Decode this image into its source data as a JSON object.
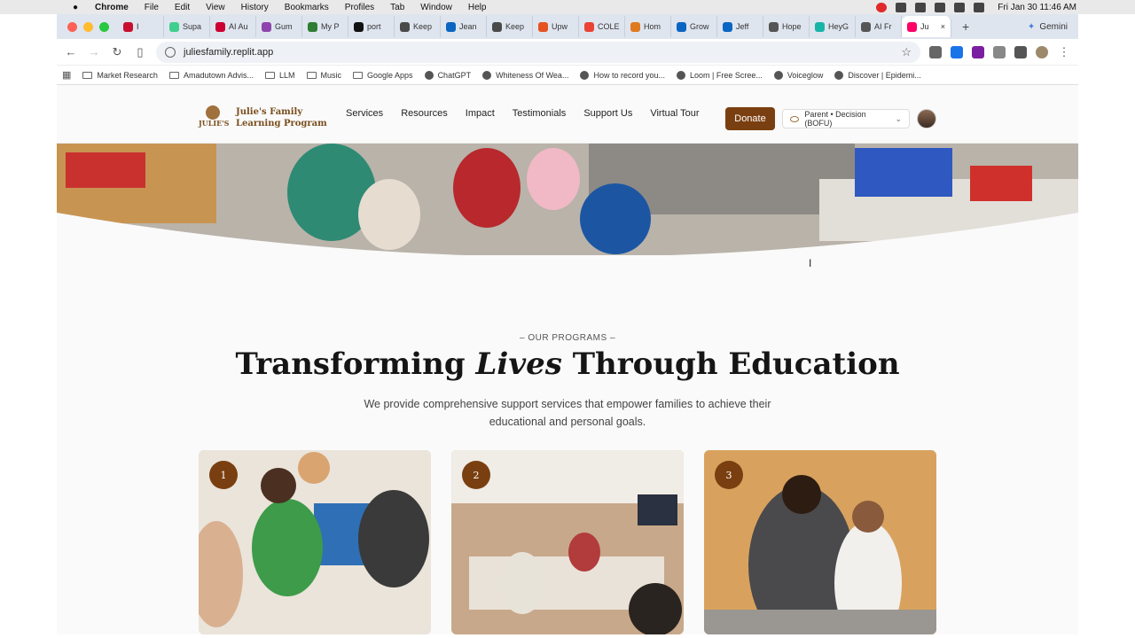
{
  "mac": {
    "app": "Chrome",
    "menus": [
      "File",
      "Edit",
      "View",
      "History",
      "Bookmarks",
      "Profiles",
      "Tab",
      "Window",
      "Help"
    ],
    "clock": "Fri Jan 30  11:46 AM"
  },
  "tabs": [
    {
      "label": "I",
      "color": "#c8102e"
    },
    {
      "label": "Supa",
      "color": "#3ecf8e"
    },
    {
      "label": "AI Au",
      "color": "#c03"
    },
    {
      "label": "Gum",
      "color": "#8e44ad"
    },
    {
      "label": "My P",
      "color": "#2e7d32"
    },
    {
      "label": "port",
      "color": "#111"
    },
    {
      "label": "Keep",
      "color": "#4a4a4a"
    },
    {
      "label": "Jean",
      "color": "#0a66c2"
    },
    {
      "label": "Keep",
      "color": "#4a4a4a"
    },
    {
      "label": "Upw",
      "color": "#e6521f"
    },
    {
      "label": "COLE",
      "color": "#ea4335"
    },
    {
      "label": "Hom",
      "color": "#e07a1f"
    },
    {
      "label": "Grow",
      "color": "#0a66c2"
    },
    {
      "label": "Jeff",
      "color": "#0a66c2"
    },
    {
      "label": "Hope",
      "color": "#555"
    },
    {
      "label": "HeyG",
      "color": "#19b4a8"
    },
    {
      "label": "AI Fr",
      "color": "#555"
    },
    {
      "label": "Ju",
      "color": "#f06"
    }
  ],
  "gemini": "Gemini",
  "url": "juliesfamily.replit.app",
  "bookmarks": [
    "Market Research",
    "Amadutown Advis...",
    "LLM",
    "Music",
    "Google Apps",
    "ChatGPT",
    "Whiteness Of Wea...",
    "How to record you...",
    "Loom | Free Scree...",
    "Voiceglow",
    "Discover | Epidemi..."
  ],
  "site": {
    "logo_line1": "Julie's Family",
    "logo_line2": "Learning Program",
    "logo_mark": "JULIE'S",
    "nav": [
      "Services",
      "Resources",
      "Impact",
      "Testimonials",
      "Support Us",
      "Virtual Tour"
    ],
    "donate": "Donate",
    "persona": "Parent • Decision (BOFU)"
  },
  "section": {
    "kicker": "– OUR PROGRAMS –",
    "title_a": "Transforming ",
    "title_em": "Lives",
    "title_b": " Through Education",
    "lead": "We provide comprehensive support services that empower families to achieve their educational and personal goals."
  },
  "cards": [
    {
      "num": "1"
    },
    {
      "num": "2"
    },
    {
      "num": "3"
    }
  ],
  "colors": {
    "brand": "#7a3f10",
    "accent": "#a0703d"
  }
}
